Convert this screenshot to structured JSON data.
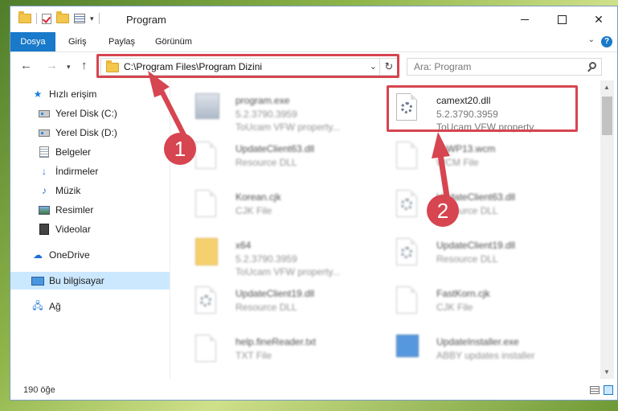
{
  "window": {
    "title": "Program",
    "controls": {
      "minimize": "",
      "maximize": "",
      "close": "✕"
    }
  },
  "ribbon": {
    "tabs": [
      "Dosya",
      "Giriş",
      "Paylaş",
      "Görünüm"
    ],
    "help": "?"
  },
  "address": {
    "path": "C:\\Program Files\\Program Dizini",
    "search_placeholder": "Ara: Program"
  },
  "nav": {
    "items": [
      {
        "label": "Hızlı erişim",
        "icon": "star-icon"
      },
      {
        "label": "Yerel Disk (C:)",
        "icon": "drive-icon",
        "pinned": true
      },
      {
        "label": "Yerel Disk (D:)",
        "icon": "drive-icon",
        "pinned": true
      },
      {
        "label": "Belgeler",
        "icon": "documents-icon",
        "pinned": true
      },
      {
        "label": "İndirmeler",
        "icon": "downloads-icon",
        "pinned": true
      },
      {
        "label": "Müzik",
        "icon": "music-icon",
        "pinned": true
      },
      {
        "label": "Resimler",
        "icon": "pictures-icon",
        "pinned": true
      },
      {
        "label": "Videolar",
        "icon": "videos-icon",
        "pinned": true
      },
      {
        "label": "OneDrive",
        "icon": "cloud-icon"
      },
      {
        "label": "Bu bilgisayar",
        "icon": "computer-icon",
        "selected": true
      },
      {
        "label": "Ağ",
        "icon": "network-icon"
      }
    ]
  },
  "files": [
    {
      "name": "program.exe",
      "line2": "5.2.3790.3959",
      "line3": "ToUcam VFW property...",
      "icon": "exe-icon"
    },
    {
      "name": "camext20.dll",
      "line2": "5.2.3790.3959",
      "line3": "ToUcam VFW property...",
      "icon": "dll-file-icon"
    },
    {
      "name": "UpdateClient63.dll",
      "line2": "Resource DLL",
      "line3": "",
      "icon": "dll-file-icon"
    },
    {
      "name": "ToWP13.wcm",
      "line2": "WCM File",
      "line3": "",
      "icon": "file-icon"
    },
    {
      "name": "Korean.cjk",
      "line2": "CJK File",
      "line3": "",
      "icon": "file-icon"
    },
    {
      "name": "UpdateClient63.dll",
      "line2": "Resource DLL",
      "line3": "",
      "icon": "dll-file-icon"
    },
    {
      "name": "x64",
      "line2": "5.2.3790.3959",
      "line3": "ToUcam VFW property...",
      "icon": "folder-icon"
    },
    {
      "name": "UpdateClient19.dll",
      "line2": "Resource DLL",
      "line3": "",
      "icon": "dll-file-icon"
    },
    {
      "name": "UpdateClient19.dll",
      "line2": "Resource DLL",
      "line3": "",
      "icon": "dll-file-icon"
    },
    {
      "name": "FastKorn.cjk",
      "line2": "CJK File",
      "line3": "",
      "icon": "file-icon"
    },
    {
      "name": "help.fineReader.txt",
      "line2": "TXT File",
      "line3": "",
      "icon": "file-icon"
    },
    {
      "name": "UpdateInstaller.exe",
      "line2": "ABBY updates installer",
      "line3": "",
      "icon": "installer-icon"
    }
  ],
  "status": {
    "count": "190 öğe"
  },
  "annotations": {
    "step1": "1",
    "step2": "2",
    "color": "#d64550"
  }
}
